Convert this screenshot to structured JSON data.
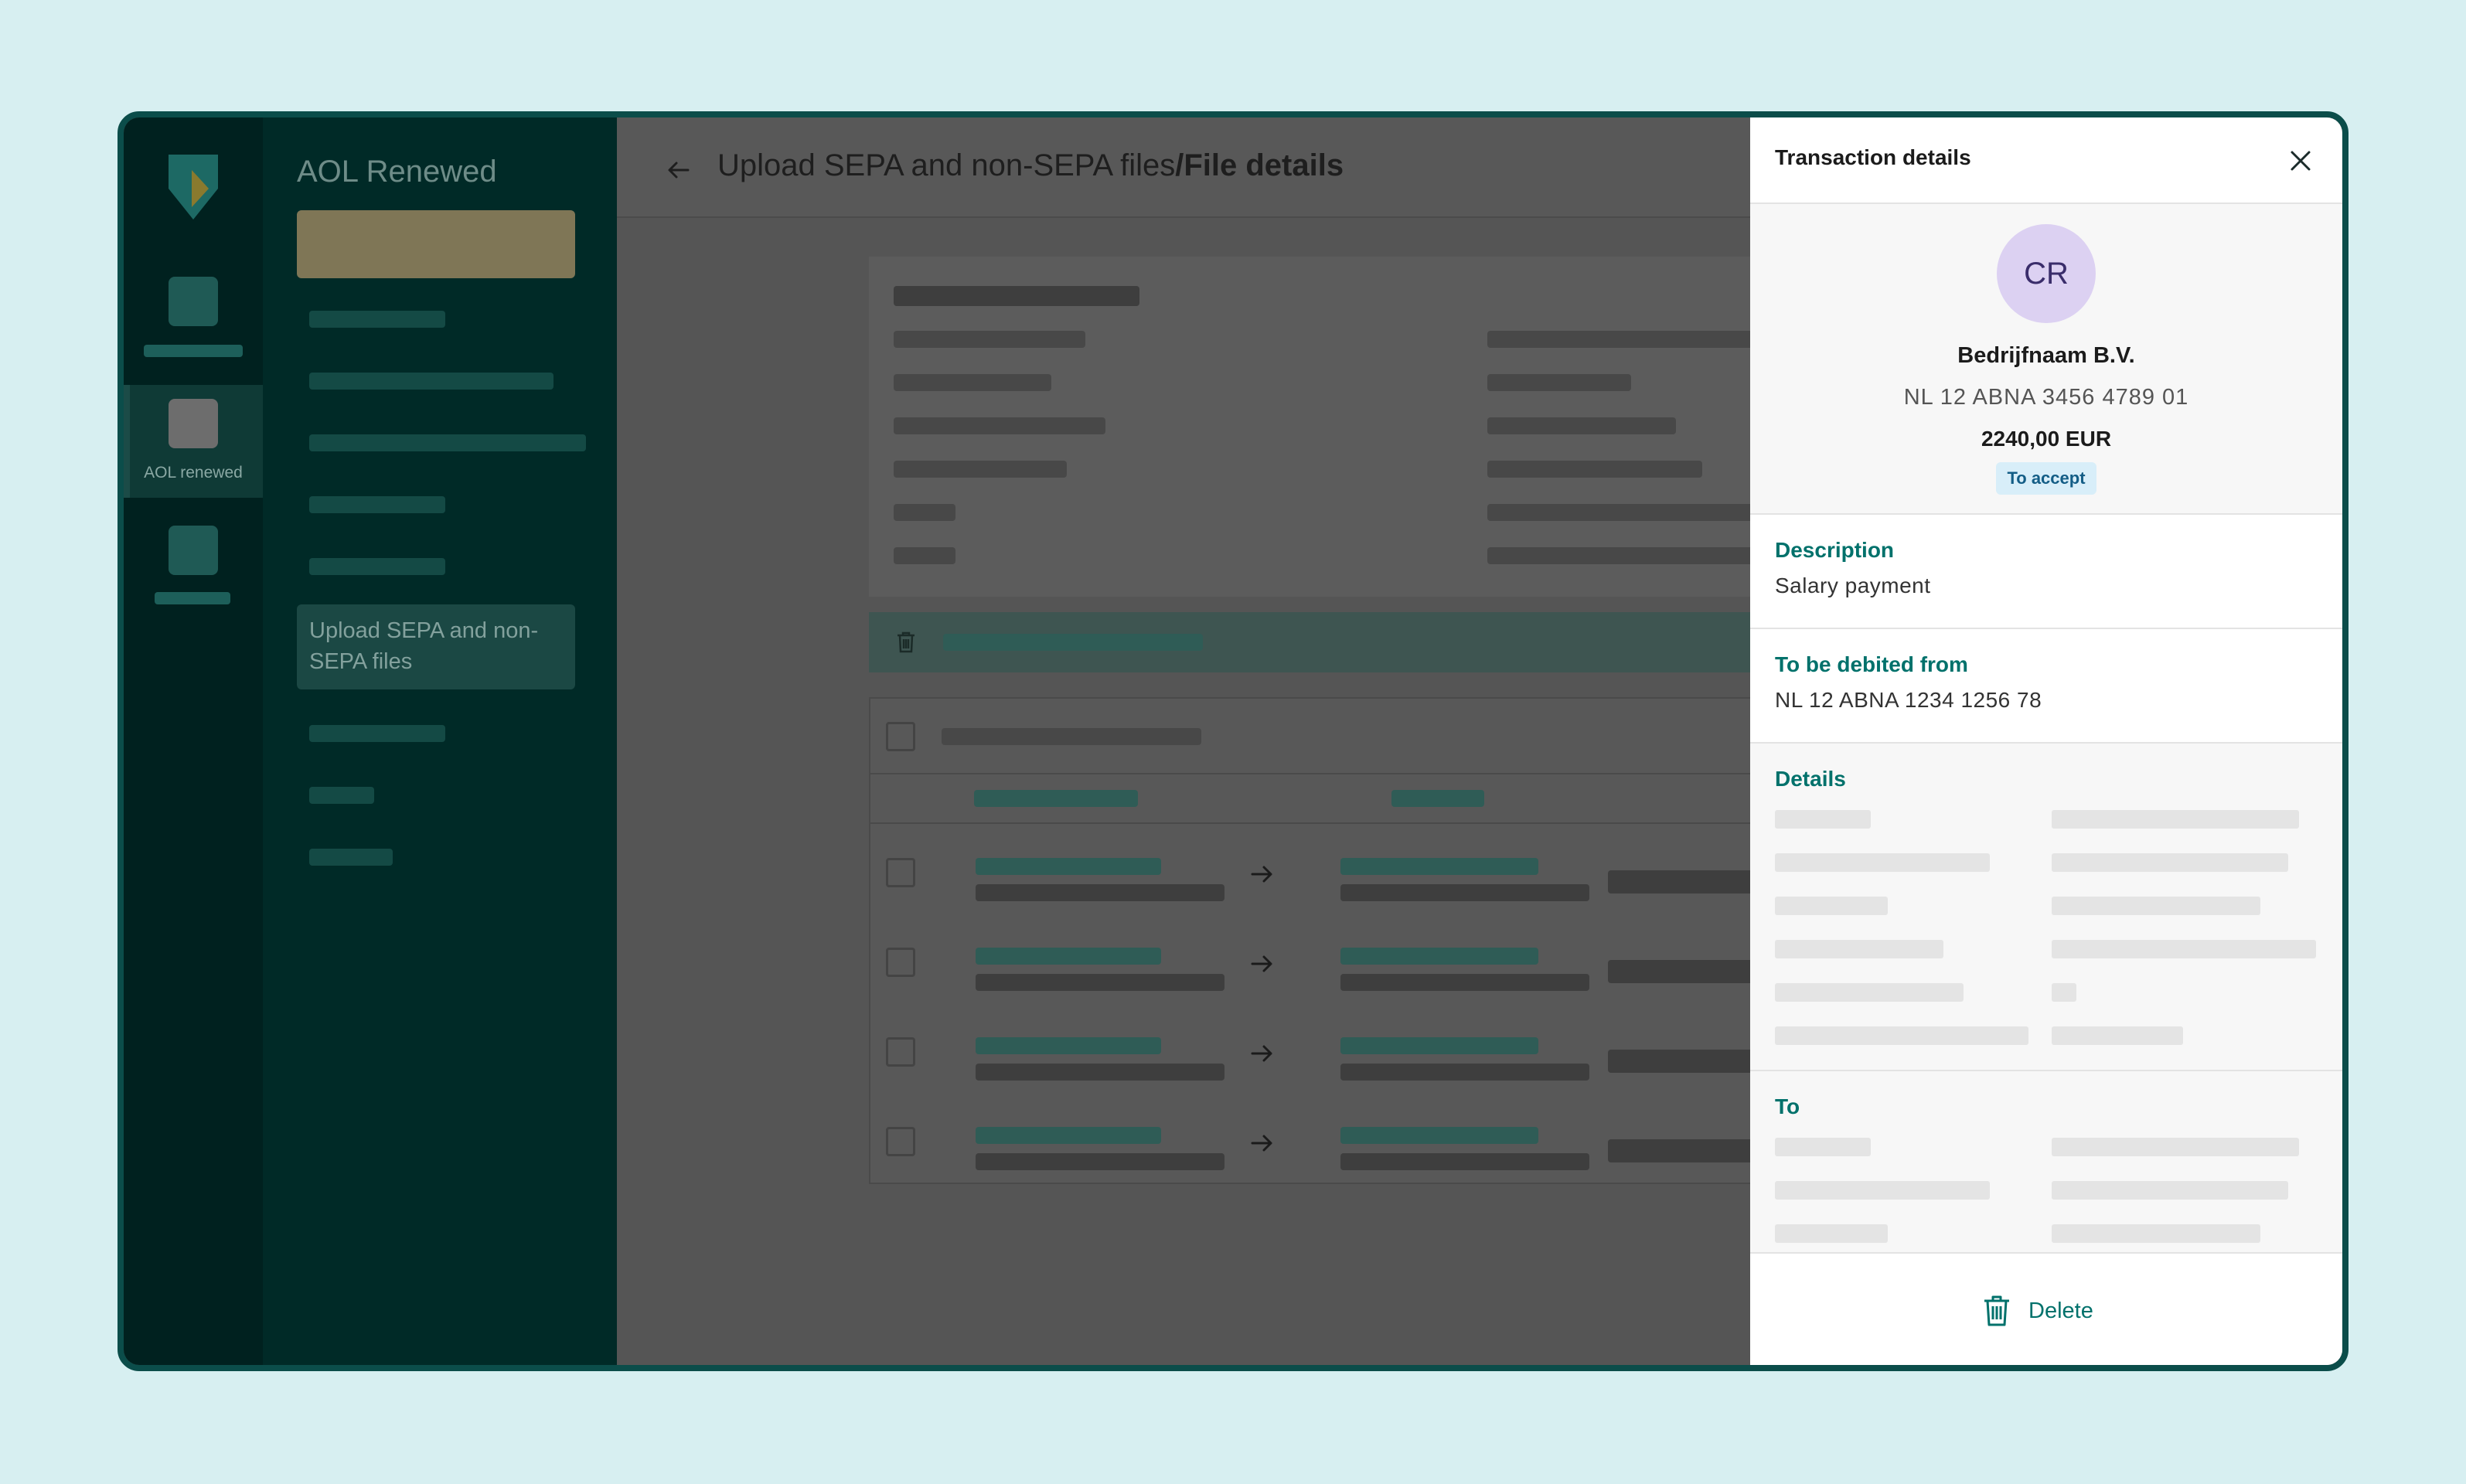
{
  "rail": {
    "active_label": "AOL renewed"
  },
  "sidenav": {
    "title": "AOL Renewed",
    "selected_item": "Upload SEPA and non-SEPA files"
  },
  "header": {
    "title_main": "Upload SEPA and non-SEPA files",
    "title_detail": "/File details"
  },
  "panel": {
    "title": "Transaction details",
    "avatar_initials": "CR",
    "counterparty_name": "Bedrijfnaam B.V.",
    "counterparty_iban": "NL 12 ABNA 3456 4789 01",
    "amount": "2240,00 EUR",
    "status": "To accept",
    "description": {
      "label": "Description",
      "value": "Salary payment"
    },
    "debit": {
      "label": "To be debited from",
      "value": "NL 12 ABNA 1234 1256 78"
    },
    "details": {
      "label": "Details"
    },
    "to": {
      "label": "To"
    },
    "delete_label": "Delete"
  },
  "colors": {
    "brand_teal": "#00716b",
    "frame": "#0b4d4a",
    "badge_bg": "#d8eef9",
    "avatar_bg": "#dcd1f2"
  },
  "icons": {
    "back": "arrow-left-icon",
    "close": "close-icon",
    "delete": "trash-icon",
    "row_arrow": "arrow-right-icon"
  }
}
